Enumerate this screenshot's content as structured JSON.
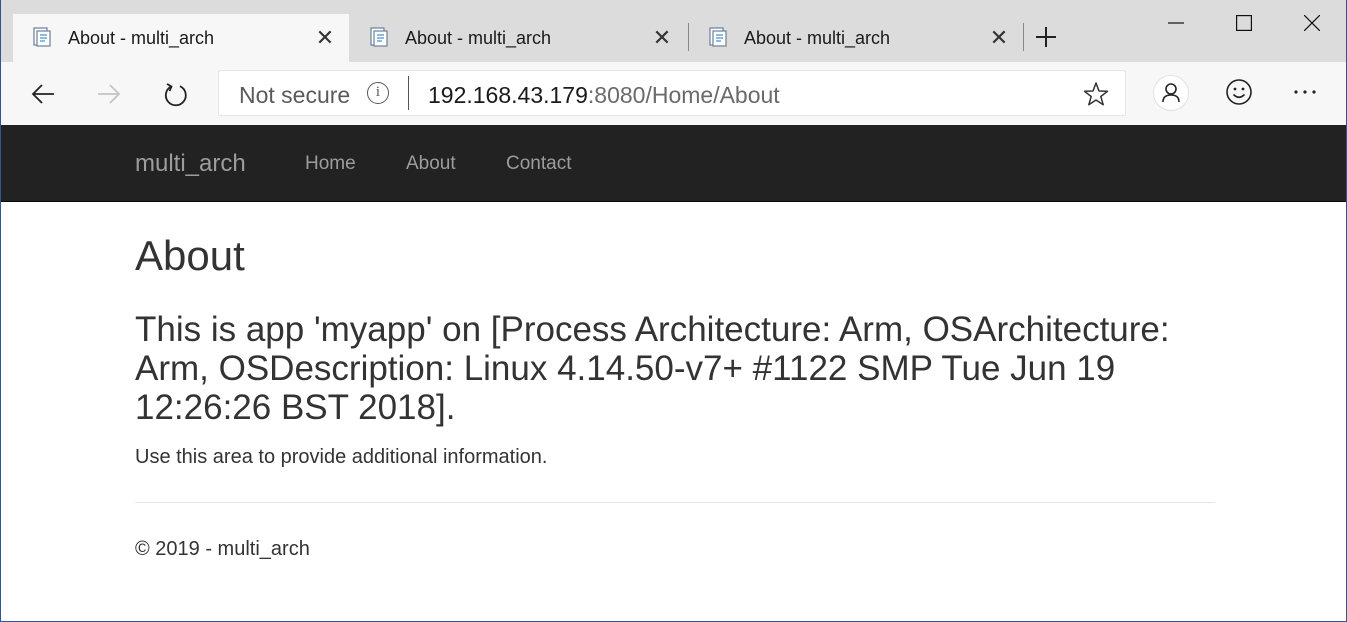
{
  "browser": {
    "tabs": [
      {
        "title": "About - multi_arch",
        "active": true
      },
      {
        "title": "About - multi_arch",
        "active": false
      },
      {
        "title": "About - multi_arch",
        "active": false
      }
    ],
    "security_label": "Not secure",
    "url_host": "192.168.43.179",
    "url_rest": ":8080/Home/About",
    "icons": {
      "back": "back-arrow-icon",
      "forward": "forward-arrow-icon",
      "refresh": "refresh-icon",
      "info": "info-icon",
      "favorite": "star-icon",
      "profile": "profile-icon",
      "feedback": "smiley-icon",
      "more": "more-icon",
      "new_tab": "plus-icon",
      "close_tab": "close-icon",
      "minimize": "minimize-icon",
      "maximize": "maximize-icon",
      "close_window": "close-window-icon"
    },
    "colors": {
      "tabstrip": "#dcdcdc",
      "toolbar": "#f7f7f7"
    }
  },
  "site": {
    "brand": "multi_arch",
    "nav": [
      "Home",
      "About",
      "Contact"
    ],
    "navbar_color": "#222222"
  },
  "page": {
    "title": "About",
    "info": "This is app 'myapp' on [Process Architecture: Arm, OSArchitecture: Arm, OSDescription: Linux 4.14.50-v7+ #1122 SMP Tue Jun 19 12:26:26 BST 2018].",
    "additional": "Use this area to provide additional information.",
    "footer": "© 2019 - multi_arch"
  }
}
